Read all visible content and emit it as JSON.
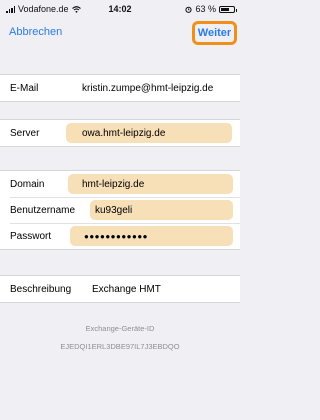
{
  "statusbar": {
    "carrier": "Vodafone.de",
    "time": "14:02",
    "battery": "63 %",
    "battery_level": 0.63,
    "icons": [
      "signal-icon",
      "wifi-icon",
      "alarm-icon",
      "battery-icon"
    ]
  },
  "navbar": {
    "cancel": "Abbrechen",
    "next": "Weiter",
    "accent": "#2c7ce6",
    "highlight": "#f0901c"
  },
  "fields": {
    "email": {
      "label": "E-Mail",
      "value": "kristin.zumpe@hmt-leipzig.de"
    },
    "server": {
      "label": "Server",
      "value": "owa.hmt-leipzig.de"
    },
    "domain": {
      "label": "Domain",
      "value": "hmt-leipzig.de"
    },
    "username": {
      "label": "Benutzername",
      "value": "ku93geli"
    },
    "password": {
      "label": "Passwort",
      "value": "●●●●●●●●●●●●"
    },
    "description": {
      "label": "Beschreibung",
      "value": "Exchange HMT"
    }
  },
  "footer": {
    "title": "Exchange-Geräte-ID",
    "id": "EJEDQI1ERL3DBE97IL7J3EBDQO"
  }
}
